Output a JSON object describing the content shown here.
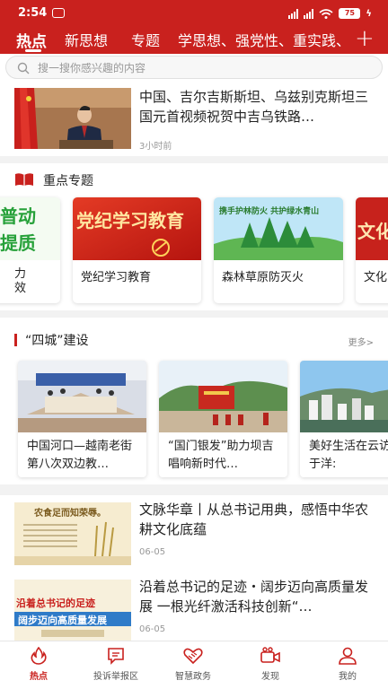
{
  "status_bar": {
    "time": "2:54",
    "battery": "75",
    "network": "5G"
  },
  "tabs": {
    "items": [
      "热点",
      "新思想",
      "专题"
    ],
    "long_tab": "学思想、强党性、重实践、建新功",
    "add_icon": "plus-icon"
  },
  "search": {
    "placeholder": "搜一搜你感兴趣的内容"
  },
  "headline": {
    "title": "中国、吉尔吉斯斯坦、乌兹别克斯坦三国元首视频祝贺中吉乌铁路…",
    "time": "3小时前"
  },
  "topics": {
    "section_title": "重点专题",
    "partial_left_banner": "普动 提质",
    "partial_left_label": "力\n效",
    "cards": [
      {
        "label": "党纪学习教育",
        "banner_text": "党纪学习教育"
      },
      {
        "label": "森林草原防灭火",
        "banner_text": "携手护林防火 共护绿水青山"
      },
      {
        "label": "文化",
        "banner_text": "文化"
      }
    ]
  },
  "sicheng": {
    "title": "“四城”建设",
    "more": "更多>",
    "cards": [
      {
        "title": "中国河口—越南老街第八次双边教…"
      },
      {
        "title": "“国门银发”助力坝吉唱响新时代…"
      },
      {
        "title": "美好生活在云访谈丨于洋:"
      }
    ]
  },
  "articles": [
    {
      "title": "文脉华章丨从总书记用典，感悟中华农耕文化底蕴",
      "date": "06-05",
      "thumb_heading": "农食足而知荣辱。"
    },
    {
      "title": "沿着总书记的足迹・阔步迈向高质量发展 一根光纤激活科技创新“…",
      "date": "06-05",
      "thumb_heading": "沿着总书记的足迹 阔步迈向高质量发展"
    }
  ],
  "bottom_nav": [
    {
      "label": "热点",
      "icon": "flame-icon",
      "active": true
    },
    {
      "label": "投诉举报区",
      "icon": "report-icon",
      "active": false
    },
    {
      "label": "智慧政务",
      "icon": "handshake-icon",
      "active": false
    },
    {
      "label": "发现",
      "icon": "camera-icon",
      "active": false
    },
    {
      "label": "我的",
      "icon": "user-icon",
      "active": false
    }
  ],
  "colors": {
    "brand_red": "#c9211e",
    "text": "#222222",
    "muted": "#999999",
    "background": "#f2f2f2"
  }
}
